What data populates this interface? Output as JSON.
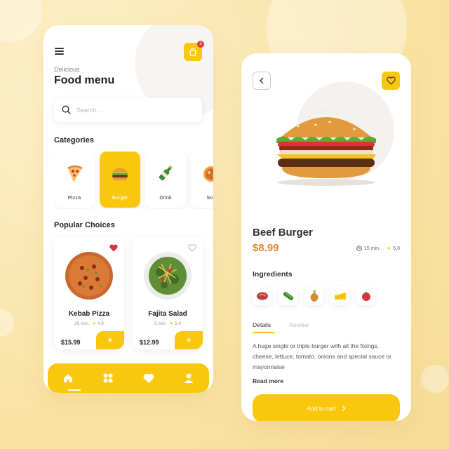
{
  "colors": {
    "accent": "#f9c80e",
    "price": "#e8862a",
    "heart_red": "#d9343a",
    "background": "#fbe9b8"
  },
  "left_screen": {
    "cart_badge_count": "3",
    "subtitle": "Delicious",
    "title": "Food menu",
    "search": {
      "placeholder": "Search..."
    },
    "categories_title": "Categories",
    "categories": [
      {
        "label": "Pizza",
        "icon": "pizza-slice-icon",
        "active": false
      },
      {
        "label": "Burger",
        "icon": "burger-icon",
        "active": true
      },
      {
        "label": "Drink",
        "icon": "bottle-icon",
        "active": false
      },
      {
        "label": "Sou",
        "icon": "soup-icon",
        "active": false
      }
    ],
    "popular_title": "Popular Choices",
    "cards": [
      {
        "name": "Kebab Pizza",
        "time": "25 min.",
        "rating": "4.9",
        "price": "$15.99",
        "favorite": true,
        "add_label": "+"
      },
      {
        "name": "Fajita Salad",
        "time": "5 min.",
        "rating": "5.0",
        "price": "$12.99",
        "favorite": false,
        "add_label": "+"
      }
    ],
    "bottom_nav": [
      "home-icon",
      "grid-icon",
      "heart-icon",
      "user-icon"
    ]
  },
  "right_screen": {
    "dish_name": "Beef Burger",
    "price": "$8.99",
    "time": "15 min.",
    "rating": "5.0",
    "ingredients_title": "Ingredients",
    "ingredients": [
      "meat-icon",
      "cucumber-icon",
      "onion-icon",
      "cheese-icon",
      "tomato-icon"
    ],
    "tabs": {
      "details": "Details",
      "review": "Review"
    },
    "description": "A huge single or triple burger with all the fixings, cheese, lettuce, tomato, onions and special sauce or mayonnaise",
    "read_more": "Read more",
    "add_to_cart": "Add to cart"
  }
}
